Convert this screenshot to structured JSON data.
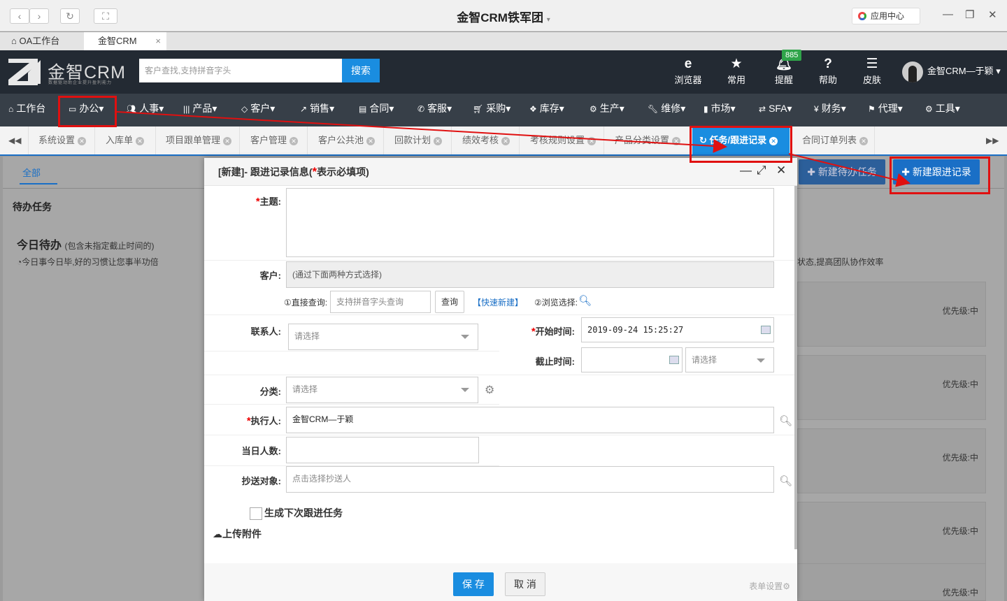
{
  "browser": {
    "title": "金智CRM铁军团",
    "app_center": "应用中心",
    "tabs": [
      {
        "label": "OA工作台"
      },
      {
        "label": "金智CRM"
      }
    ],
    "tab_close": "×"
  },
  "header": {
    "logo_text": "金智CRM",
    "logo_sub": "数据驱动助企业提升盈利能力",
    "search_placeholder": "客户查找,支持拼音字头",
    "search_button": "搜索",
    "tools": [
      {
        "label": "浏览器",
        "icon": "ie-icon"
      },
      {
        "label": "常用",
        "icon": "star-icon"
      },
      {
        "label": "提醒",
        "icon": "bell-icon"
      },
      {
        "label": "帮助",
        "icon": "help-icon"
      },
      {
        "label": "皮肤",
        "icon": "skin-icon"
      }
    ],
    "badge": "885",
    "user": "金智CRM—于颖"
  },
  "main_nav": [
    {
      "label": "工作台",
      "icon": "home-icon",
      "dropdown": false
    },
    {
      "label": "办公",
      "icon": "laptop-icon",
      "dropdown": true
    },
    {
      "label": "人事",
      "icon": "users-icon",
      "dropdown": true
    },
    {
      "label": "产品",
      "icon": "barcode-icon",
      "dropdown": true
    },
    {
      "label": "客户",
      "icon": "diamond-icon",
      "dropdown": true
    },
    {
      "label": "销售",
      "icon": "chart-icon",
      "dropdown": true
    },
    {
      "label": "合同",
      "icon": "contract-icon",
      "dropdown": true
    },
    {
      "label": "客服",
      "icon": "phone-icon",
      "dropdown": true
    },
    {
      "label": "采购",
      "icon": "cart-icon",
      "dropdown": true
    },
    {
      "label": "库存",
      "icon": "cubes-icon",
      "dropdown": true
    },
    {
      "label": "生产",
      "icon": "cogs-icon",
      "dropdown": true
    },
    {
      "label": "维修",
      "icon": "wrench-icon",
      "dropdown": true
    },
    {
      "label": "市场",
      "icon": "bookmark-icon",
      "dropdown": true
    },
    {
      "label": "SFA",
      "icon": "retweet-icon",
      "dropdown": true
    },
    {
      "label": "财务",
      "icon": "yen-icon",
      "dropdown": true
    },
    {
      "label": "代理",
      "icon": "flag-icon",
      "dropdown": true
    },
    {
      "label": "工具",
      "icon": "gear-icon",
      "dropdown": true
    }
  ],
  "page_tabs": [
    {
      "label": "系统设置"
    },
    {
      "label": "入库单"
    },
    {
      "label": "项目跟单管理"
    },
    {
      "label": "客户管理"
    },
    {
      "label": "客户公共池"
    },
    {
      "label": "回款计划"
    },
    {
      "label": "绩效考核"
    },
    {
      "label": "考核规则设置"
    },
    {
      "label": "产品分类设置"
    },
    {
      "label": "任务/跟进记录",
      "active": true
    },
    {
      "label": "合同订单列表"
    }
  ],
  "background": {
    "all_tab": "全部",
    "todo_heading": "待办任务",
    "today_title": "今日待办",
    "today_note": "(包含未指定截止时间的)",
    "today_sub": "今日事今日毕,好的习惯让您事半功倍",
    "right_tip": "状态,提高团队协作效率",
    "btn_new_task": "新建待办任务",
    "btn_new_follow": "新建跟进记录",
    "priority": "优先级:中"
  },
  "modal": {
    "title_prefix": "[新建]- 跟进记录信息(",
    "title_star": "*",
    "title_suffix": "表示必填项)",
    "subject_label": "主题:",
    "customer_label": "客户:",
    "customer_hint": "(通过下面两种方式选择)",
    "direct_query": "①直接查询:",
    "query_placeholder": "支持拼音字头查询",
    "query_btn": "查询",
    "quick_new": "【快速新建】",
    "browse_select": "②浏览选择:",
    "contact_label": "联系人:",
    "contact_value": "请选择",
    "start_label": "开始时间:",
    "start_value": "2019-09-24 15:25:27",
    "end_label": "截止时间:",
    "end_select": "请选择",
    "category_label": "分类:",
    "category_value": "请选择",
    "executor_label": "执行人:",
    "executor_value": "金智CRM—于颖",
    "daycount_label": "当日人数:",
    "cc_label": "抄送对象:",
    "cc_placeholder": "点击选择抄送人",
    "gen_next": "生成下次跟进任务",
    "upload": "上传附件",
    "save": "保 存",
    "cancel": "取 消",
    "form_settings": "表单设置"
  },
  "colors": {
    "accent": "#1a8de0",
    "highlight": "#e01010",
    "nav": "#373f48",
    "topbar": "#232a33"
  }
}
